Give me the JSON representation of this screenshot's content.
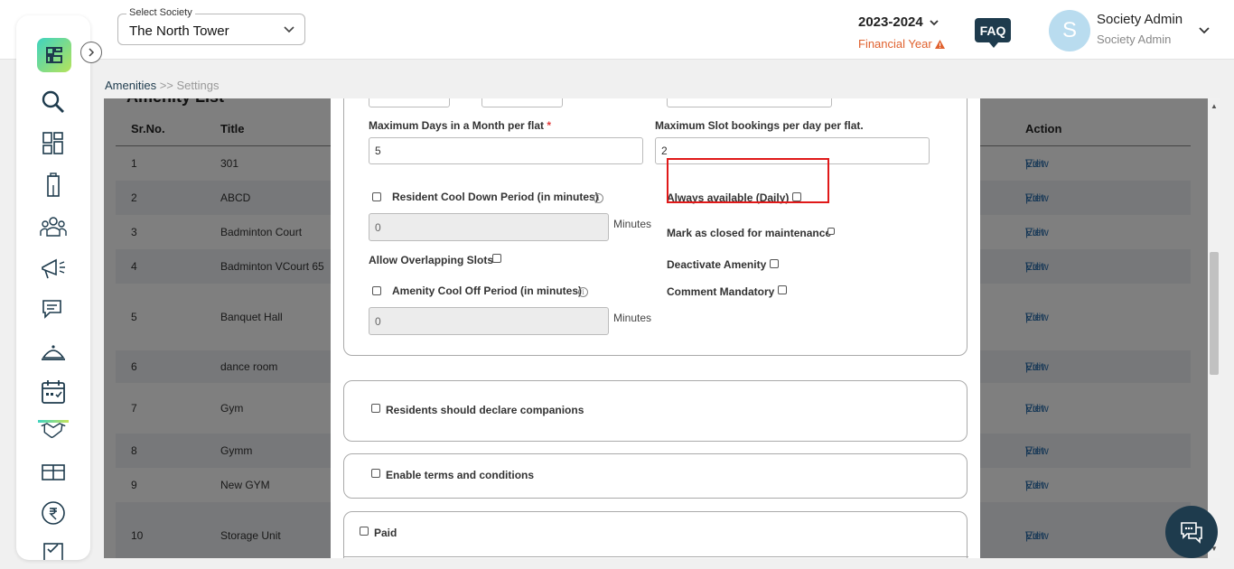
{
  "header": {
    "society_label": "Select Society",
    "society_value": "The North Tower",
    "year": "2023-2024",
    "fy_label": "Financial Year",
    "faq": "FAQ",
    "avatar_initial": "S",
    "user_name": "Society Admin",
    "user_role": "Society Admin"
  },
  "sidebar": {
    "icons": [
      "search-icon",
      "dashboard-icon",
      "building-icon",
      "people-icon",
      "announcement-icon",
      "chat-icon",
      "service-icon",
      "calendar-icon",
      "handshake-icon",
      "package-icon",
      "rupee-icon",
      "checklist-icon"
    ],
    "active": "calendar-icon"
  },
  "breadcrumb": {
    "current": "Amenities",
    "separator": ">>",
    "page": "Settings"
  },
  "list": {
    "title": "Amenity List",
    "headers": {
      "srno": "Sr.No.",
      "title": "Title",
      "action": "Action"
    },
    "rows": [
      {
        "no": "1",
        "title": "301"
      },
      {
        "no": "2",
        "title": "ABCD"
      },
      {
        "no": "3",
        "title": "Badminton Court"
      },
      {
        "no": "4",
        "title": "Badminton VCourt 65"
      },
      {
        "no": "5",
        "title": "Banquet Hall"
      },
      {
        "no": "6",
        "title": "dance room"
      },
      {
        "no": "7",
        "title": "Gym"
      },
      {
        "no": "8",
        "title": "Gymm"
      },
      {
        "no": "9",
        "title": "New GYM"
      },
      {
        "no": "10",
        "title": "Storage Unit"
      }
    ],
    "view": "View",
    "sep": "|",
    "edit": "Edit"
  },
  "form": {
    "max_days_label": "Maximum Days in a Month per flat",
    "required_mark": "*",
    "max_days_value": "5",
    "max_slots_label": "Maximum Slot bookings per day per flat.",
    "max_slots_value": "2",
    "resident_cooldown_label": "Resident Cool Down Period (in minutes)",
    "resident_cooldown_value": "0",
    "minutes": "Minutes",
    "always_available_label": "Always available (Daily)",
    "mark_closed_label": "Mark as closed for maintenance",
    "allow_overlap_label": "Allow Overlapping Slots",
    "deactivate_label": "Deactivate Amenity",
    "amenity_cooloff_label": "Amenity Cool Off Period (in minutes)",
    "amenity_cooloff_value": "0",
    "comment_mandatory_label": "Comment Mandatory",
    "info_glyph": "i",
    "companions_label": "Residents should declare companions",
    "terms_label": "Enable terms and conditions",
    "paid_label": "Paid"
  }
}
